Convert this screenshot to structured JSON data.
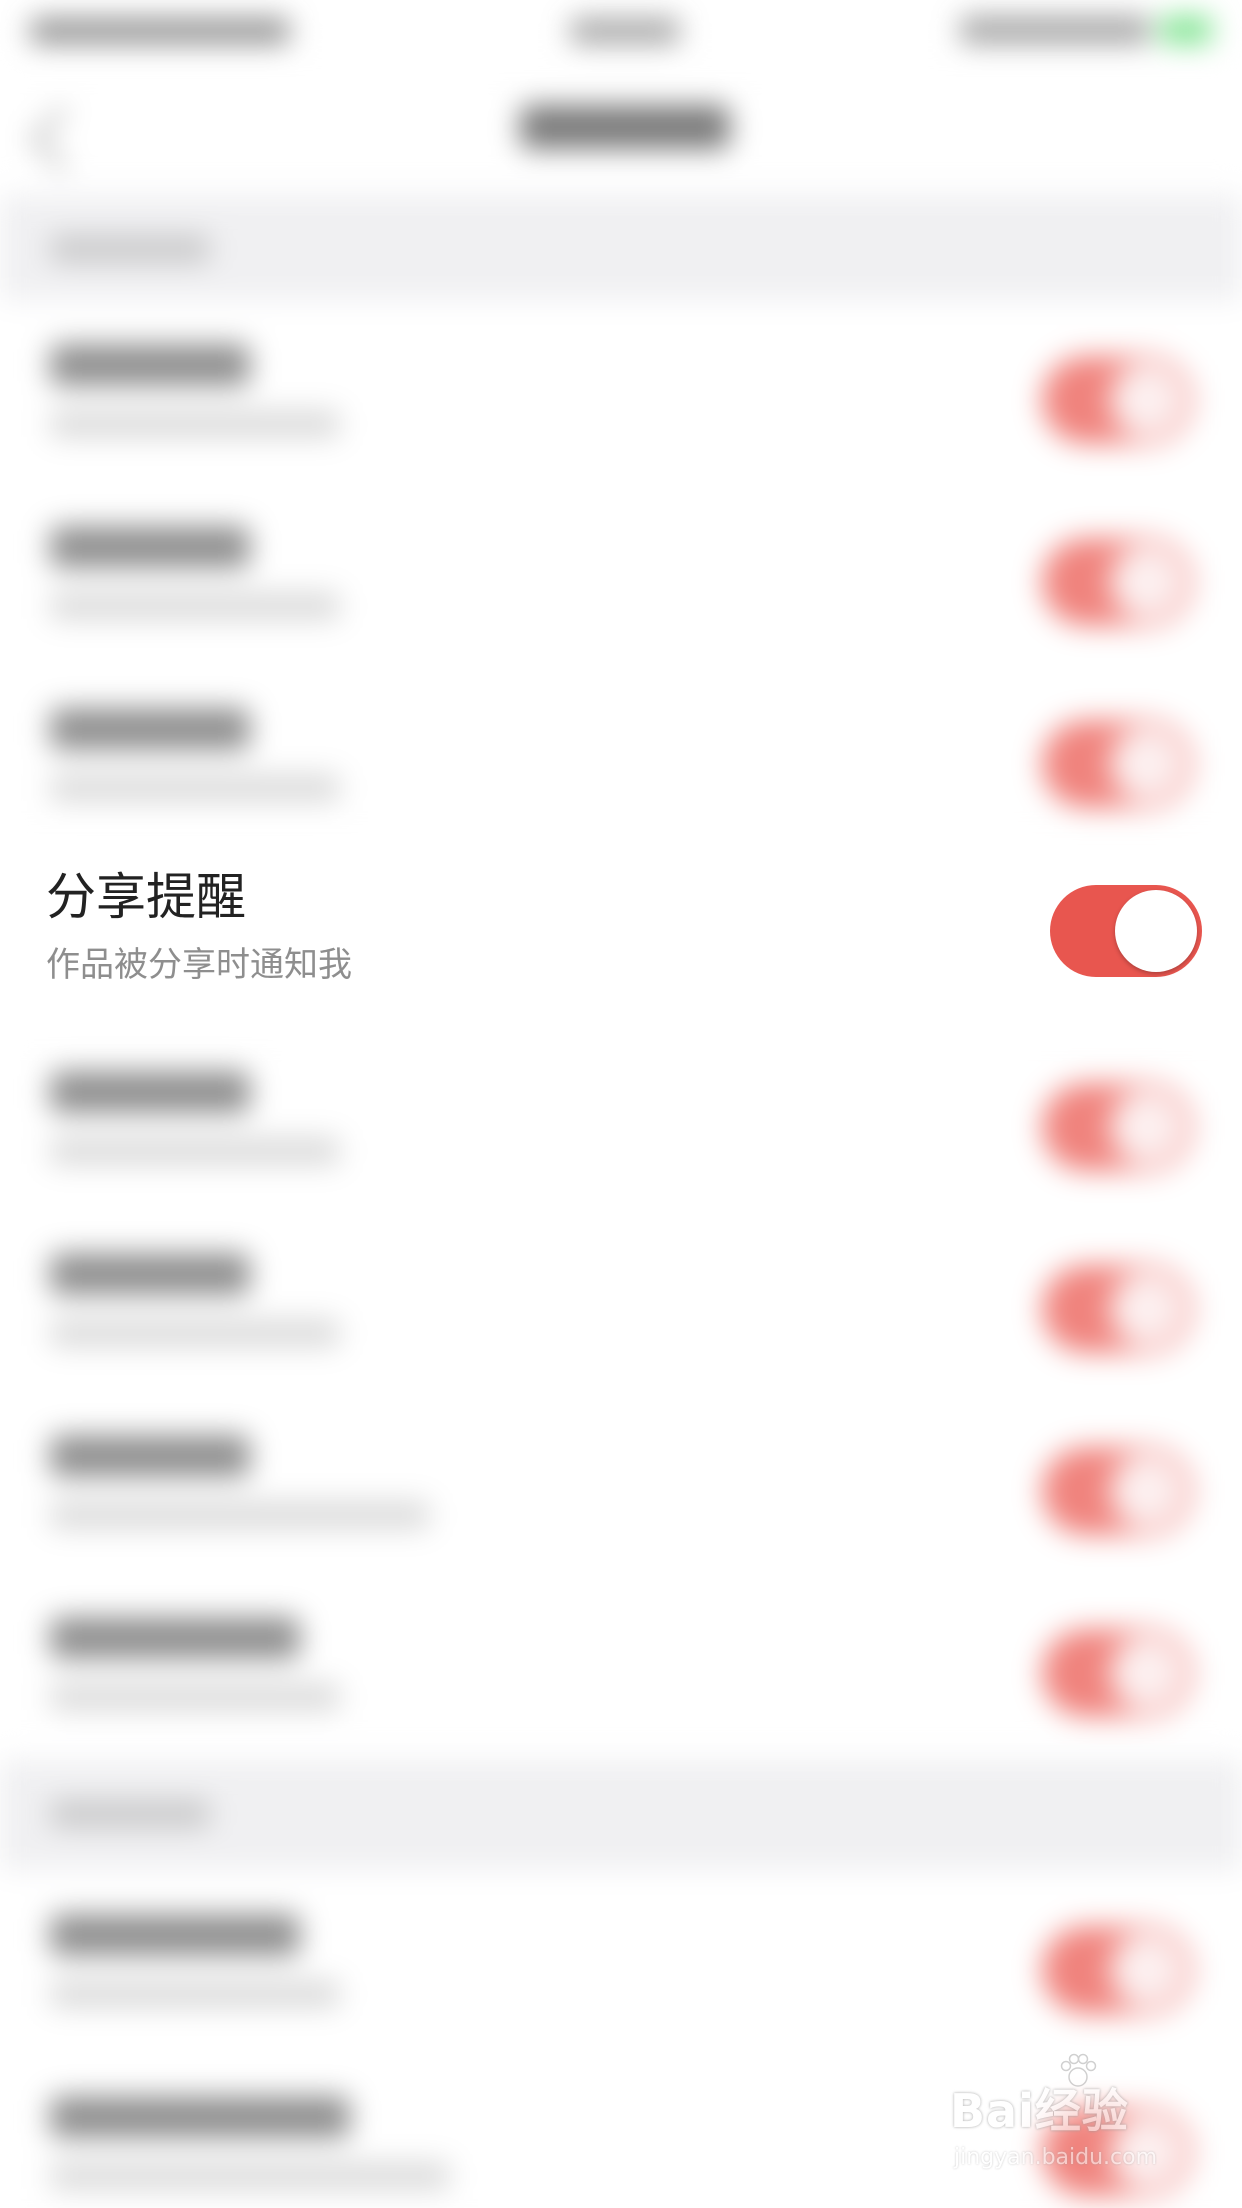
{
  "settings_item": {
    "title": "分享提醒",
    "subtitle": "作品被分享时通知我",
    "toggle_on": true,
    "accent_color": "#e8564f"
  },
  "watermark": {
    "logo": "Bai经验",
    "url": "jingyan.baidu.com",
    "icon": "paw-icon"
  }
}
